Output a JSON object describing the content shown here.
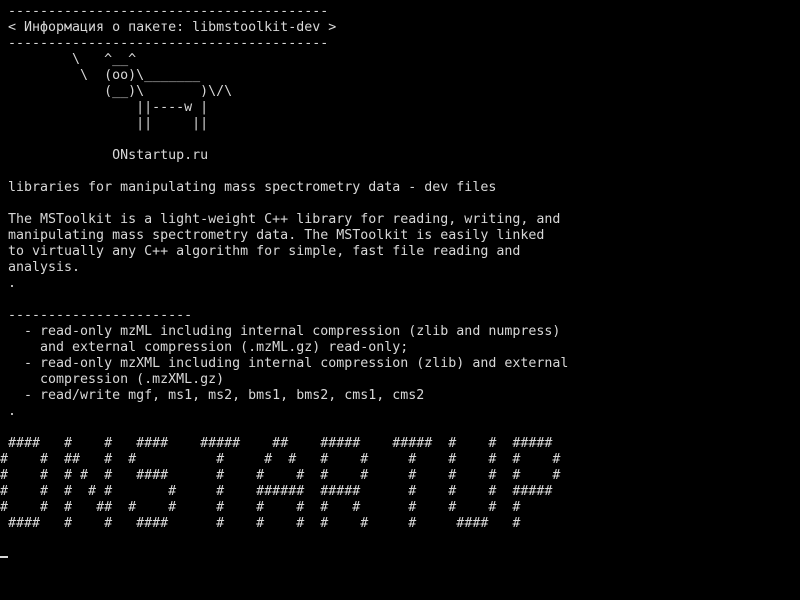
{
  "terminal": {
    "header": {
      "top_border": "----------------------------------------",
      "title": "< Информация о пакете: libmstoolkit-dev >",
      "bottom_border": "----------------------------------------"
    },
    "cow": [
      "        \\   ^__^",
      "         \\  (oo)\\_______",
      "            (__)\\       )\\/\\",
      "                ||----w |",
      "                ||     ||"
    ],
    "site": "             ONstartup.ru",
    "summary": "libraries for manipulating mass spectrometry data - dev files",
    "description": [
      "The MSToolkit is a light-weight C++ library for reading, writing, and",
      "manipulating mass spectrometry data. The MSToolkit is easily linked",
      "to virtually any C++ algorithm for simple, fast file reading and",
      "analysis.",
      "."
    ],
    "separator": "-----------------------",
    "features": [
      "  - read-only mzML including internal compression (zlib and numpress)",
      "    and external compression (.mzML.gz) read-only;",
      "  - read-only mzXML including internal compression (zlib) and external",
      "    compression (.mzXML.gz)",
      "  - read/write mgf, ms1, ms2, bms1, bms2, cms1, cms2",
      "."
    ],
    "banner": [
      " ####   #    #   ####    #####    ##    #####    #####  #    #  #####",
      "#    #  ##   #  #          #     #  #   #    #     #    #    #  #    #",
      "#    #  # #  #   ####      #    #    #  #    #     #    #    #  #    #",
      "#    #  #  # #       #     #    ######  #####      #    #    #  #####",
      "#    #  #   ##  #    #     #    #    #  #   #      #    #    #  #",
      " ####   #    #   ####      #    #    #  #    #     #     ####   #"
    ]
  }
}
